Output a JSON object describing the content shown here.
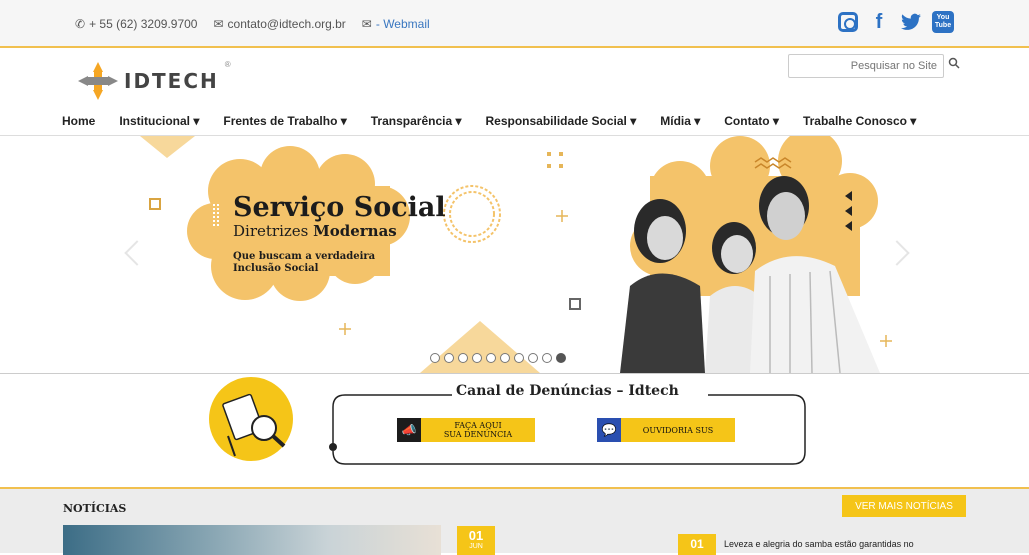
{
  "topbar": {
    "phone": "+ 55 (62) 3209.9700",
    "email": "contato@idtech.org.br",
    "webmail": "- Webmail"
  },
  "social": {
    "youtube_line1": "You",
    "youtube_line2": "Tube"
  },
  "header": {
    "logo_text": "IDTECH",
    "logo_reg": "®",
    "search_placeholder": "Pesquisar no Site"
  },
  "nav": {
    "items": [
      "Home",
      "Institucional ▾",
      "Frentes de Trabalho ▾",
      "Transparência ▾",
      "Responsabilidade Social ▾",
      "Mídia ▾",
      "Contato ▾",
      "Trabalhe Conosco ▾"
    ]
  },
  "hero": {
    "title": "Serviço Social",
    "subtitle_normal": "Diretrizes ",
    "subtitle_bold": "Modernas",
    "tagline_1": "Que buscam a verdadeira",
    "tagline_2": "Inclusão Social",
    "slides_total": 10,
    "active_slide": 10
  },
  "canal": {
    "title": "Canal de Denúncias – Idtech",
    "denuncia_label_1": "FAÇA AQUI",
    "denuncia_label_2": "SUA DENÚNCIA",
    "ouvidoria_label": "OUVIDORIA SUS"
  },
  "news": {
    "heading": "NOTÍCIAS",
    "more_button": "VER MAIS NOTÍCIAS",
    "item1_day": "01",
    "item1_month": "JUN",
    "item2_day": "01",
    "item2_text": "Leveza e alegria do samba estão garantidas no"
  },
  "colors": {
    "accent_yellow": "#f5c518",
    "link_blue": "#3a77c0",
    "social_blue": "#2d72c4",
    "hero_yellow": "#f4c36a"
  }
}
